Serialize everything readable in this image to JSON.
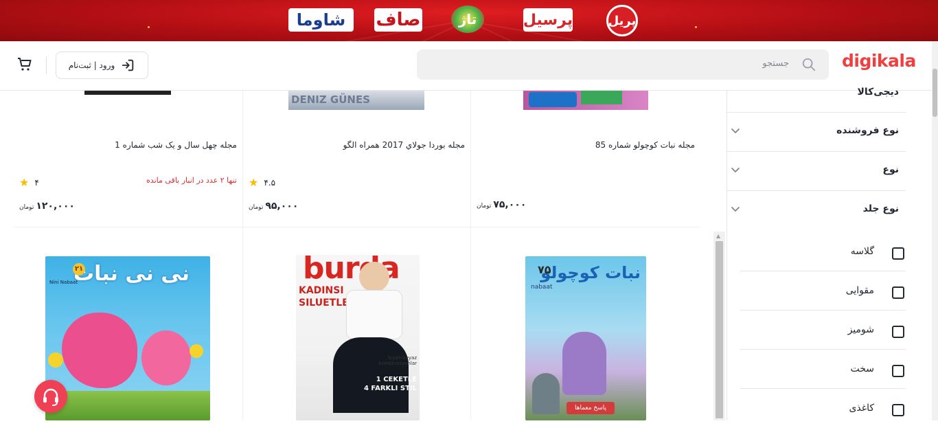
{
  "banner": {
    "brands": [
      "شاوما",
      "صاف",
      "تاژ",
      "پرسیل",
      "پریل"
    ]
  },
  "header": {
    "logo": "digikala",
    "search_placeholder": "جستجو",
    "login_label": "ورود | ثبت‌نام",
    "accent_color": "#ef4056"
  },
  "products_top": [
    {
      "title": "مجله نبات کوچولو شماره 85",
      "rating": "",
      "stock": "",
      "price": "۷۵,۰۰۰",
      "currency": "تومان"
    },
    {
      "title": "مجله بوردا جولاي 2017 همراه الگو",
      "rating": "۴.۵",
      "stock": "",
      "price": "۹۵,۰۰۰",
      "currency": "تومان"
    },
    {
      "title": "مجله چهل سال و یک شب شماره 1",
      "rating": "۴",
      "stock": "تنها ۲ عدد در انبار باقی مانده",
      "price": "۱۲۰,۰۰۰",
      "currency": "تومان"
    }
  ],
  "covers_top_text": {
    "burda_small": "DENIZ GÜNES"
  },
  "covers_bottom": {
    "nabat": {
      "title": "نبات کوچولو",
      "number": "۷۵",
      "sub": "nabaat",
      "promo": "پاسخ معماها"
    },
    "burda": {
      "title": "burda",
      "headline_1": "KADINSI",
      "headline_2": "SILUETLER",
      "tag_1": "1 CEKETLE",
      "tag_2": "4 FARKLI STIL",
      "side": "Siyah-beyaz kombinasyonlar"
    },
    "ninnabat": {
      "title": "نی نی نبات",
      "number": "۲۱",
      "sub": "Nini Nabaat"
    }
  },
  "sidebar": {
    "cut_label": "دیجی‌کالا",
    "filters": [
      {
        "label": "نوع فروشنده"
      },
      {
        "label": "نوع"
      },
      {
        "label": "نوع جلد"
      }
    ],
    "cover_options": [
      "گلاسه",
      "مقوایی",
      "شومیز",
      "سخت",
      "کاغذی"
    ]
  }
}
